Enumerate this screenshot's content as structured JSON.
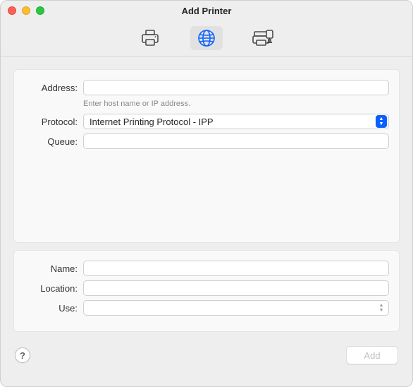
{
  "window": {
    "title": "Add Printer"
  },
  "toolbar": {
    "tabs": [
      {
        "id": "default",
        "selected": false,
        "icon": "printer-icon"
      },
      {
        "id": "ip",
        "selected": true,
        "icon": "globe-icon"
      },
      {
        "id": "windows",
        "selected": false,
        "icon": "network-printer-icon"
      }
    ]
  },
  "form": {
    "address": {
      "label": "Address:",
      "value": "",
      "hint": "Enter host name or IP address."
    },
    "protocol": {
      "label": "Protocol:",
      "value": "Internet Printing Protocol - IPP"
    },
    "queue": {
      "label": "Queue:",
      "value": ""
    },
    "name": {
      "label": "Name:",
      "value": ""
    },
    "location": {
      "label": "Location:",
      "value": ""
    },
    "use": {
      "label": "Use:",
      "value": ""
    }
  },
  "footer": {
    "help_label": "?",
    "add_label": "Add",
    "add_enabled": false
  }
}
